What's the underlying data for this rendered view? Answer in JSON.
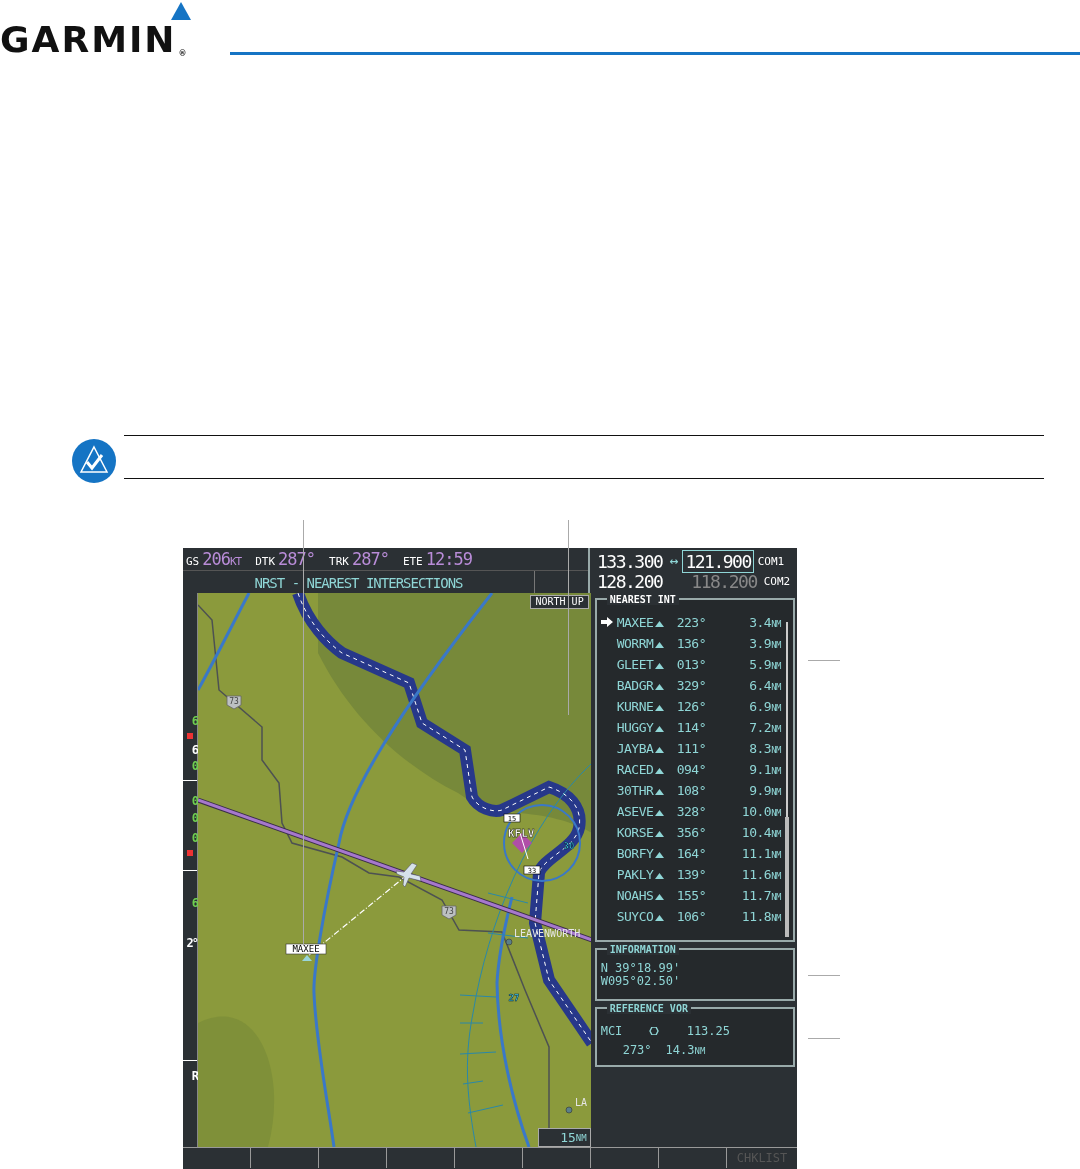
{
  "logo": {
    "name": "GARMIN",
    "mark": "®"
  },
  "screen": {
    "nav_fields": [
      {
        "label": "GS",
        "value": "206",
        "unit": "KT"
      },
      {
        "label": "DTK",
        "value": "287°"
      },
      {
        "label": "TRK",
        "value": "287°"
      },
      {
        "label": "ETE",
        "value": "12:59"
      }
    ],
    "page_title": "NRST - NEAREST INTERSECTIONS",
    "com": [
      {
        "active": "133.300",
        "swap": "↔",
        "standby": "121.900",
        "standby_selected": true,
        "name": "COM1"
      },
      {
        "active": "128.200",
        "standby": "118.200",
        "standby_selected": false,
        "name": "COM2"
      }
    ],
    "left_strip": [
      {
        "text": "6",
        "color": "#6fcf4f"
      },
      {
        "text": "6",
        "color": "#ffffff"
      },
      {
        "text": "0",
        "color": "#6fcf4f"
      },
      {
        "text": "0",
        "color": "#6fcf4f"
      },
      {
        "text": "0",
        "color": "#6fcf4f"
      },
      {
        "text": "0",
        "color": "#6fcf4f"
      },
      {
        "text": "6",
        "color": "#6fcf4f"
      },
      {
        "text": "2°",
        "color": "#ffffff"
      },
      {
        "text": "R",
        "color": "#ffffff"
      }
    ],
    "map": {
      "orientation": "NORTH UP",
      "range": "15",
      "range_unit": "NM",
      "highway_shields": [
        "73",
        "73"
      ],
      "airport": {
        "name": "KFLV",
        "runway_ends": [
          "15",
          "33"
        ]
      },
      "airspace_labels": [
        "30",
        "27"
      ],
      "towns": [
        "LEAVENWORTH",
        "LA"
      ],
      "waypoint_label": "MAXEE"
    },
    "nearest_int": {
      "title": "NEAREST INT",
      "rows": [
        {
          "name": "MAXEE",
          "bearing": "223°",
          "distance": "3.4",
          "unit": "NM",
          "selected": true
        },
        {
          "name": "WORRM",
          "bearing": "136°",
          "distance": "3.9",
          "unit": "NM",
          "selected": false
        },
        {
          "name": "GLEET",
          "bearing": "013°",
          "distance": "5.9",
          "unit": "NM",
          "selected": false
        },
        {
          "name": "BADGR",
          "bearing": "329°",
          "distance": "6.4",
          "unit": "NM",
          "selected": false
        },
        {
          "name": "KURNE",
          "bearing": "126°",
          "distance": "6.9",
          "unit": "NM",
          "selected": false
        },
        {
          "name": "HUGGY",
          "bearing": "114°",
          "distance": "7.2",
          "unit": "NM",
          "selected": false
        },
        {
          "name": "JAYBA",
          "bearing": "111°",
          "distance": "8.3",
          "unit": "NM",
          "selected": false
        },
        {
          "name": "RACED",
          "bearing": "094°",
          "distance": "9.1",
          "unit": "NM",
          "selected": false
        },
        {
          "name": "30THR",
          "bearing": "108°",
          "distance": "9.9",
          "unit": "NM",
          "selected": false
        },
        {
          "name": "ASEVE",
          "bearing": "328°",
          "distance": "10.0",
          "unit": "NM",
          "selected": false
        },
        {
          "name": "KORSE",
          "bearing": "356°",
          "distance": "10.4",
          "unit": "NM",
          "selected": false
        },
        {
          "name": "BORFY",
          "bearing": "164°",
          "distance": "11.1",
          "unit": "NM",
          "selected": false
        },
        {
          "name": "PAKLY",
          "bearing": "139°",
          "distance": "11.6",
          "unit": "NM",
          "selected": false
        },
        {
          "name": "NOAHS",
          "bearing": "155°",
          "distance": "11.7",
          "unit": "NM",
          "selected": false
        },
        {
          "name": "SUYCO",
          "bearing": "106°",
          "distance": "11.8",
          "unit": "NM",
          "selected": false
        }
      ]
    },
    "information": {
      "title": "INFORMATION",
      "latitude": "N 39°18.99'",
      "longitude": "W095°02.50'"
    },
    "reference_vor": {
      "title": "REFERENCE VOR",
      "ident": "MCI",
      "frequency": "113.25",
      "bearing": "273°",
      "distance": "14.3",
      "unit": "NM"
    },
    "softkeys": [
      {
        "label": "CHKLIST",
        "disabled": true
      }
    ]
  }
}
